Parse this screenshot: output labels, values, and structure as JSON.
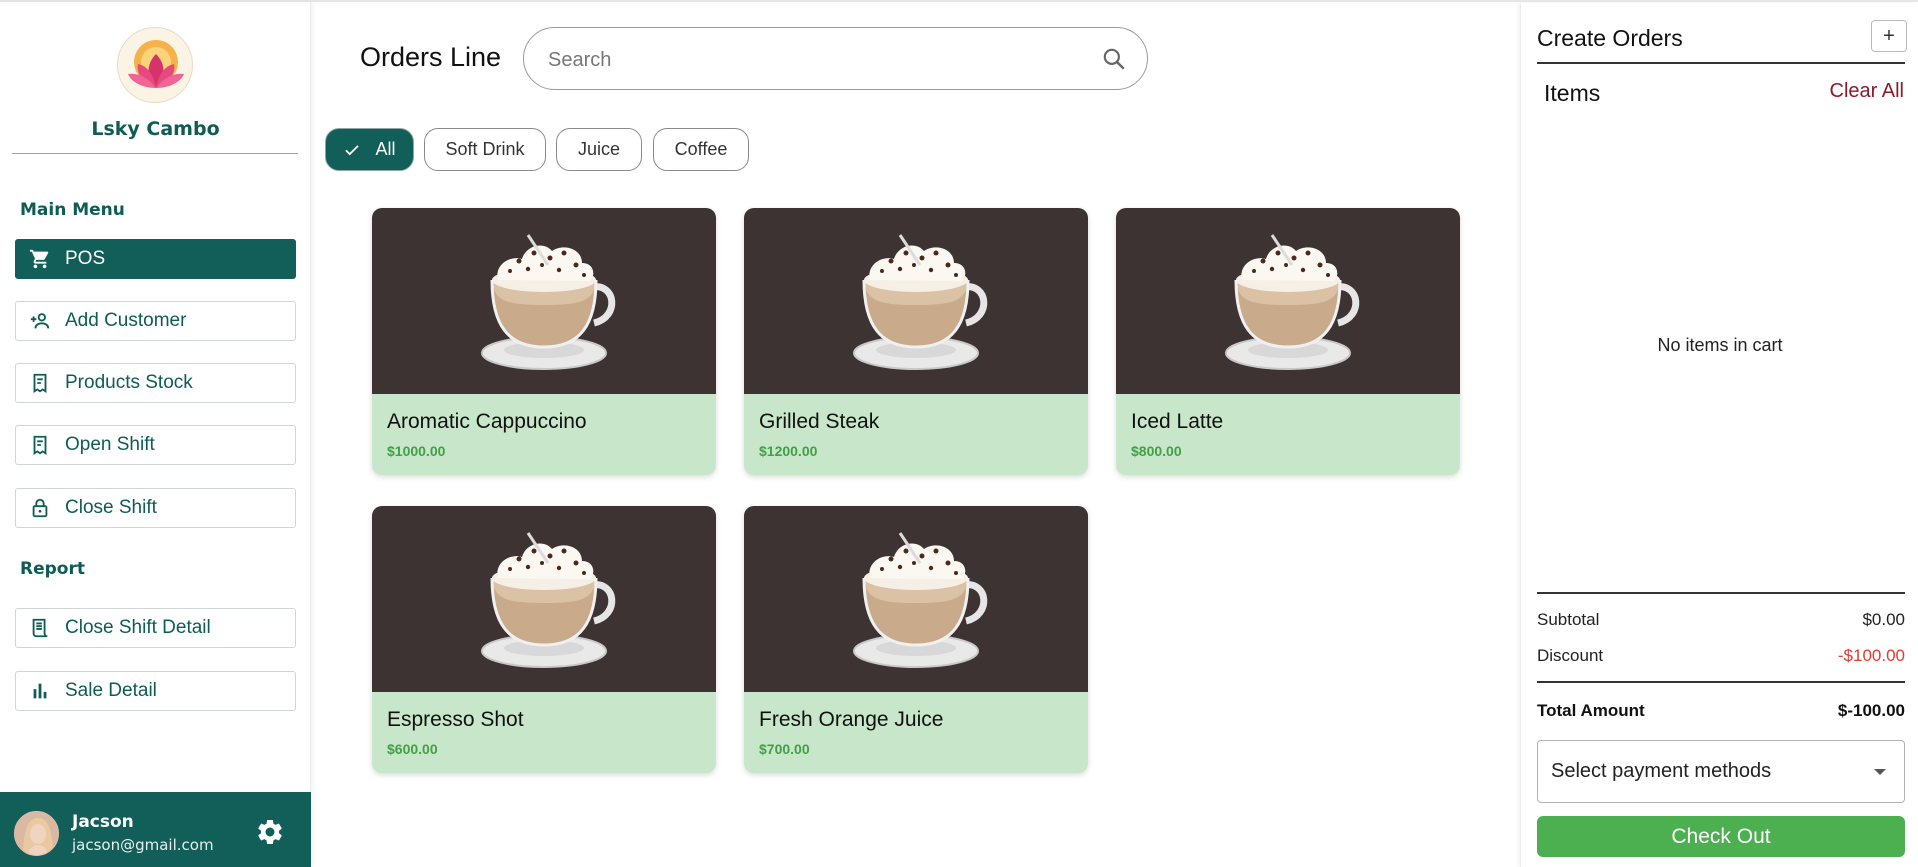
{
  "sidebar": {
    "brand": "Lsky Cambo",
    "main_menu_title": "Main Menu",
    "items": [
      {
        "label": "POS",
        "icon": "cart-icon"
      },
      {
        "label": "Add Customer",
        "icon": "person-add-icon"
      },
      {
        "label": "Products Stock",
        "icon": "receipt-icon"
      },
      {
        "label": "Open Shift",
        "icon": "receipt-icon"
      },
      {
        "label": "Close Shift",
        "icon": "lock-icon"
      }
    ],
    "report_title": "Report",
    "report_items": [
      {
        "label": "Close Shift Detail",
        "icon": "receipt-long-icon"
      },
      {
        "label": "Sale Detail",
        "icon": "bar-chart-icon"
      }
    ],
    "user": {
      "name": "Jacson",
      "email": "jacson@gmail.com"
    }
  },
  "header": {
    "title": "Orders Line",
    "search": {
      "placeholder": "Search",
      "value": ""
    }
  },
  "filters": [
    {
      "label": "All",
      "active": true
    },
    {
      "label": "Soft Drink",
      "active": false
    },
    {
      "label": "Juice",
      "active": false
    },
    {
      "label": "Coffee",
      "active": false
    }
  ],
  "products": [
    {
      "name": "Aromatic Cappuccino",
      "price": "$1000.00"
    },
    {
      "name": "Grilled Steak",
      "price": "$1200.00"
    },
    {
      "name": "Iced Latte",
      "price": "$800.00"
    },
    {
      "name": "Espresso Shot",
      "price": "$600.00"
    },
    {
      "name": "Fresh Orange Juice",
      "price": "$700.00"
    }
  ],
  "cart": {
    "title": "Create Orders",
    "add_label": "+",
    "items_label": "Items",
    "clear_all": "Clear All",
    "empty_text": "No items in cart",
    "subtotal_label": "Subtotal",
    "subtotal_value": "$0.00",
    "discount_label": "Discount",
    "discount_value": "-$100.00",
    "total_label": "Total Amount",
    "total_value": "$-100.00",
    "payment_placeholder": "Select payment methods",
    "checkout_label": "Check Out"
  },
  "colors": {
    "brand": "#125e58",
    "card_bg": "#c8e6c9",
    "price": "#43a047",
    "checkout": "#4caf50",
    "clear_all": "#8b1a2b",
    "discount": "#e53935"
  }
}
